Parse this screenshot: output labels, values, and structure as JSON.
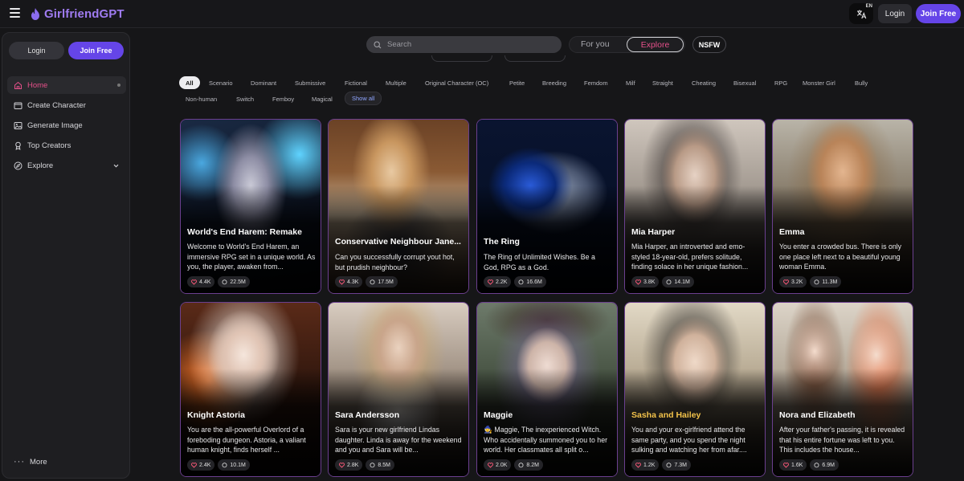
{
  "header": {
    "logo_text": "GirlfriendGPT",
    "lang_badge": "EN",
    "login_label": "Login",
    "join_label": "Join Free"
  },
  "sidebar": {
    "login_label": "Login",
    "join_label": "Join Free",
    "items": [
      {
        "label": "Home",
        "icon": "home-icon"
      },
      {
        "label": "Create Character",
        "icon": "create-icon"
      },
      {
        "label": "Generate Image",
        "icon": "image-icon"
      },
      {
        "label": "Top Creators",
        "icon": "award-icon"
      },
      {
        "label": "Explore",
        "icon": "compass-icon"
      }
    ],
    "more_label": "More"
  },
  "search": {
    "placeholder": "Search"
  },
  "tabs": {
    "for_you": "For you",
    "explore": "Explore",
    "nsfw": "NSFW"
  },
  "categories": {
    "row1": [
      "All",
      "Scenario",
      "Dominant",
      "Submissive",
      "Fictional",
      "Multiple",
      "Original Character (OC)",
      "Petite",
      "Breeding",
      "Femdom",
      "Milf",
      "Straight",
      "Cheating",
      "Bisexual",
      "RPG",
      "Monster Girl",
      "Bully"
    ],
    "row2": [
      "Non-human",
      "Switch",
      "Femboy",
      "Magical",
      "Show all"
    ]
  },
  "colors": {
    "accent": "#6545e8",
    "active_pink": "#e5508a",
    "card_border": "#6b3f8f",
    "gold_name": "#f2c24a"
  },
  "cards": [
    {
      "name": "World's End Harem: Remake",
      "desc": "Welcome to World's End Harem, an immersive RPG set in a unique world. As you, the player, awaken from...",
      "likes": "4.4K",
      "chats": "22.5M"
    },
    {
      "name": "Conservative Neighbour Jane...",
      "desc": "Can you successfully corrupt yout hot, but prudish neighbour?",
      "likes": "4.3K",
      "chats": "17.5M"
    },
    {
      "name": "The Ring",
      "desc": "The Ring of Unlimited Wishes. Be a God, RPG as a God.",
      "likes": "2.2K",
      "chats": "16.6M"
    },
    {
      "name": "Mia Harper",
      "desc": "Mia Harper, an introverted and emo-styled 18-year-old, prefers solitude, finding solace in her unique fashion...",
      "likes": "3.8K",
      "chats": "14.1M"
    },
    {
      "name": "Emma",
      "desc": "You enter a crowded bus. There is only one place left next to a beautiful young woman Emma.",
      "likes": "3.2K",
      "chats": "11.3M"
    },
    {
      "name": "Knight Astoria",
      "desc": "You are the all-powerful Overlord of a foreboding dungeon. Astoria, a valiant human knight, finds herself ...",
      "likes": "2.4K",
      "chats": "10.1M"
    },
    {
      "name": "Sara Andersson",
      "desc": "Sara is your new girlfriend Lindas daughter. Linda is away for the weekend and you and Sara will be...",
      "likes": "2.8K",
      "chats": "8.5M"
    },
    {
      "name": "Maggie",
      "desc": "🧙 Maggie, The inexperienced Witch. Who accidentally summoned you to her world. Her classmates all split o...",
      "likes": "2.0K",
      "chats": "8.2M"
    },
    {
      "name": "Sasha and Hailey",
      "desc": "You and your ex-girlfriend attend the same party, and you spend the night sulking and watching her from afar....",
      "likes": "1.2K",
      "chats": "7.3M"
    },
    {
      "name": "Nora and Elizabeth",
      "desc": "After your father's passing, it is revealed that his entire fortune was left to you. This includes the house...",
      "likes": "1.6K",
      "chats": "6.9M"
    }
  ]
}
